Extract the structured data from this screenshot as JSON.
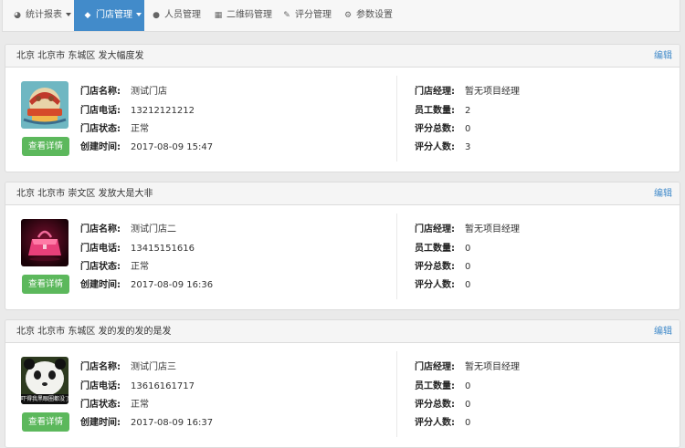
{
  "nav": {
    "items": [
      {
        "label": "统计报表",
        "icon": "pie-chart-icon"
      },
      {
        "label": "门店管理",
        "icon": "tag-icon"
      },
      {
        "label": "人员管理",
        "icon": "users-icon"
      },
      {
        "label": "二维码管理",
        "icon": "qrcode-icon"
      },
      {
        "label": "评分管理",
        "icon": "edit-icon"
      },
      {
        "label": "参数设置",
        "icon": "gears-icon"
      }
    ]
  },
  "labels": {
    "name": "门店名称:",
    "phone": "门店电话:",
    "status": "门店状态:",
    "created": "创建时间:",
    "manager": "门店经理:",
    "staff": "员工数量:",
    "score_total": "评分总数:",
    "score_count": "评分人数:",
    "edit": "编辑",
    "detail": "查看详情"
  },
  "stores": [
    {
      "address": "北京 北京市 东城区 发大幅度发",
      "name": "测试门店",
      "phone": "13212121212",
      "status": "正常",
      "created": "2017-08-09 15:47",
      "manager": "暂无项目经理",
      "staff": "2",
      "score_total": "0",
      "score_count": "3",
      "image": "cartoon-store-image"
    },
    {
      "address": "北京 北京市 崇文区 发放大是大非",
      "name": "测试门店二",
      "phone": "13415151616",
      "status": "正常",
      "created": "2017-08-09 16:36",
      "manager": "暂无项目经理",
      "staff": "0",
      "score_total": "0",
      "score_count": "0",
      "image": "pink-handbag-image"
    },
    {
      "address": "北京 北京市 东城区 发的发的发的是发",
      "name": "测试门店三",
      "phone": "13616161717",
      "status": "正常",
      "created": "2017-08-09 16:37",
      "manager": "暂无项目经理",
      "staff": "0",
      "score_total": "0",
      "score_count": "0",
      "image": "panda-meme-image",
      "image_caption": "吓得我黑眼圈都没了"
    }
  ],
  "colors": {
    "primary": "#428bca",
    "success": "#5cb85c",
    "panel_head": "#f5f5f5"
  }
}
